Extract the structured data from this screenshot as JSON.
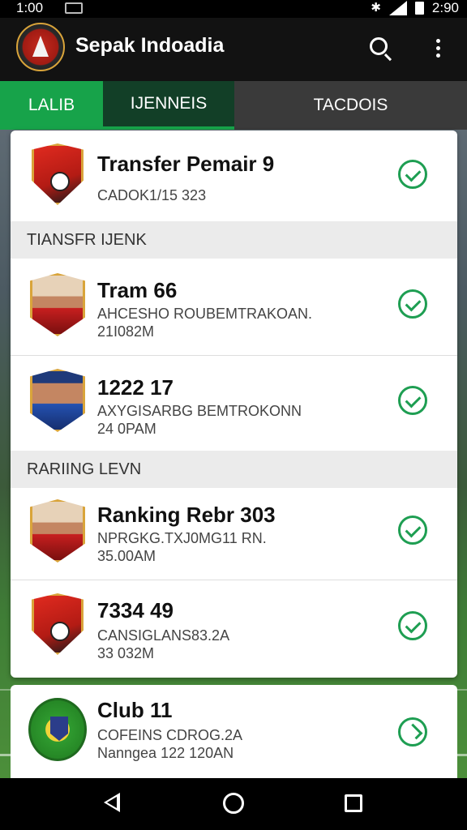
{
  "status_bar": {
    "time": "1:00",
    "clock_right": "2:90",
    "icons": [
      "notification-icon",
      "bluetooth-icon",
      "signal-icon",
      "battery-icon"
    ]
  },
  "app_bar": {
    "title": "Sepak Indoadia",
    "icons": [
      "logo-icon",
      "search-icon",
      "more-vert-icon"
    ]
  },
  "tabs": [
    {
      "label": "LALIB"
    },
    {
      "label": "IJENNEIS"
    },
    {
      "label": "TACDOIS"
    }
  ],
  "top_item": {
    "title": "Transfer Pemair 9",
    "subtitle": "CADOK1/15 323"
  },
  "sections": [
    {
      "header": "TIANSFR IJENK",
      "items": [
        {
          "title": "Tram 66",
          "line1": "AHCESHO ROUBEMTRAKOAN.",
          "line2": "21I082M"
        },
        {
          "title": "1222 17",
          "line1": "AXYGISARBG BEMTROKONN",
          "line2": "24 0PAM"
        }
      ]
    },
    {
      "header": "RARIING LEVN",
      "items": [
        {
          "title": "Ranking Rebr 303",
          "line1": "NPRGKG.TXJ0MG11 RN.",
          "line2": "35.00AM"
        },
        {
          "title": "7334 49",
          "line1": "CANSIGLANS83.2A",
          "line2": "33 032M"
        }
      ]
    }
  ],
  "bottom_item": {
    "title": "Club 11",
    "line1": "COFEINS CDROG.2A",
    "line2": "Nanngea 122 120AN"
  },
  "colors": {
    "accent_green": "#17a34a",
    "check_green": "#1e9e52",
    "app_bar": "#121212"
  }
}
